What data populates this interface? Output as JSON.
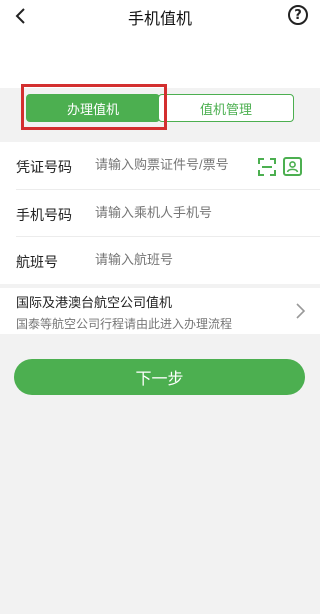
{
  "header": {
    "title": "手机值机"
  },
  "tabs": {
    "active": "办理值机",
    "inactive": "值机管理"
  },
  "form": {
    "voucher": {
      "label": "凭证号码",
      "placeholder": "请输入购票证件号/票号"
    },
    "phone": {
      "label": "手机号码",
      "placeholder": "请输入乘机人手机号"
    },
    "flight": {
      "label": "航班号",
      "placeholder": "请输入航班号"
    }
  },
  "international": {
    "title": "国际及港澳台航空公司值机",
    "subtitle": "国泰等航空公司行程请由此进入办理流程"
  },
  "actions": {
    "next": "下一步"
  }
}
